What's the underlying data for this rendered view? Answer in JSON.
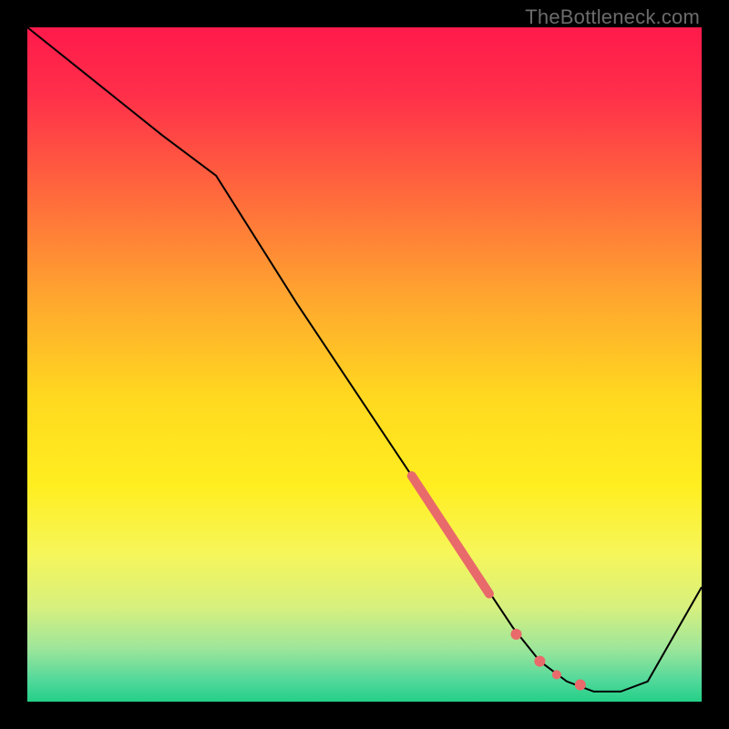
{
  "watermark": "TheBottleneck.com",
  "chart_data": {
    "type": "line",
    "title": "",
    "xlabel": "",
    "ylabel": "",
    "xlim": [
      0,
      100
    ],
    "ylim": [
      0,
      100
    ],
    "grid": false,
    "legend": false,
    "background": {
      "type": "vertical-gradient",
      "stops": [
        {
          "pos": 0.0,
          "color": "#ff1a4b"
        },
        {
          "pos": 0.1,
          "color": "#ff2f4a"
        },
        {
          "pos": 0.25,
          "color": "#ff6a3c"
        },
        {
          "pos": 0.4,
          "color": "#ffa62f"
        },
        {
          "pos": 0.55,
          "color": "#ffd91f"
        },
        {
          "pos": 0.68,
          "color": "#ffee20"
        },
        {
          "pos": 0.78,
          "color": "#f6f65a"
        },
        {
          "pos": 0.86,
          "color": "#d7f07e"
        },
        {
          "pos": 0.92,
          "color": "#9fe69a"
        },
        {
          "pos": 0.97,
          "color": "#4fd89a"
        },
        {
          "pos": 1.0,
          "color": "#24cf87"
        }
      ]
    },
    "series": [
      {
        "name": "bottleneck-curve",
        "color": "#000000",
        "width": 2,
        "x": [
          0,
          10,
          20,
          28,
          40,
          50,
          60,
          68,
          72,
          76,
          80,
          84,
          88,
          92,
          100
        ],
        "y": [
          100,
          92,
          84,
          78,
          59,
          44,
          29,
          17,
          11,
          6,
          3,
          1.5,
          1.5,
          3,
          17
        ]
      }
    ],
    "markers": [
      {
        "name": "highlight-segment",
        "type": "thick-line",
        "color": "#e96a6a",
        "width": 10,
        "x": [
          57,
          68.5
        ],
        "y": [
          33.5,
          16
        ]
      },
      {
        "name": "dot-1",
        "type": "dot",
        "color": "#e96a6a",
        "radius": 6,
        "x": 72.5,
        "y": 10
      },
      {
        "name": "dot-2",
        "type": "dot",
        "color": "#e96a6a",
        "radius": 6,
        "x": 76,
        "y": 6
      },
      {
        "name": "dot-3",
        "type": "dot",
        "color": "#e96a6a",
        "radius": 5,
        "x": 78.5,
        "y": 4
      },
      {
        "name": "dot-4",
        "type": "dot",
        "color": "#e96a6a",
        "radius": 6,
        "x": 82,
        "y": 2.5
      }
    ]
  }
}
